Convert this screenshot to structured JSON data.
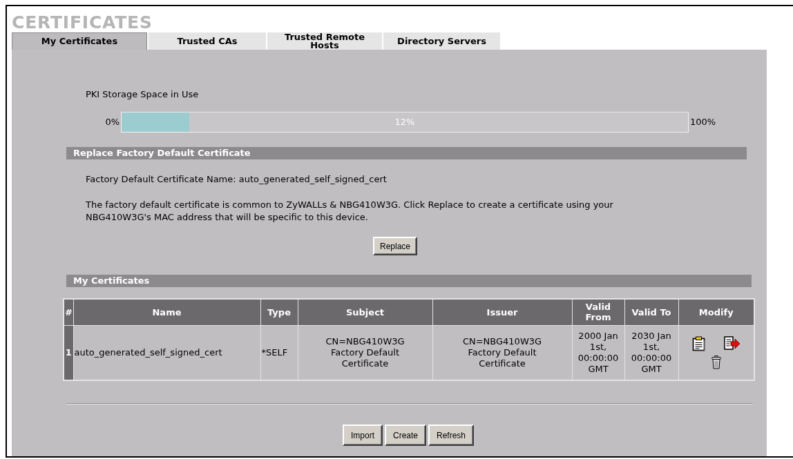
{
  "page": {
    "title": "CERTIFICATES"
  },
  "tabs": [
    {
      "label": "My Certificates",
      "selected": true
    },
    {
      "label": "Trusted CAs",
      "selected": false
    },
    {
      "label": "Trusted Remote Hosts",
      "selected": false
    },
    {
      "label": "Directory Servers",
      "selected": false
    }
  ],
  "storage": {
    "label": "PKI Storage Space in Use",
    "min_label": "0%",
    "max_label": "100%",
    "level": 0.12,
    "reading": "12%"
  },
  "replace_section": {
    "title": "Replace Factory Default Certificate",
    "name_line": "Factory Default Certificate Name: auto_generated_self_signed_cert",
    "description": "The factory default certificate is common to ZyWALLs & NBG410W3G. Click Replace to create a certificate using your NBG410W3G's MAC address that will be specific to this device.",
    "button": "Replace"
  },
  "certificates_section": {
    "title": "My Certificates",
    "table": {
      "columns": [
        "#",
        "Name",
        "Type",
        "Subject",
        "Issuer",
        "Valid From",
        "Valid To",
        "Modify"
      ],
      "rows": [
        {
          "number": "1",
          "name": "auto_generated_self_signed_cert",
          "type": "*SELF",
          "subject": "CN=NBG410W3G Factory Default Certificate",
          "issuer": "CN=NBG410W3G Factory Default Certificate",
          "valid_from": "2000 Jan 1st, 00:00:00 GMT",
          "valid_to": "2030 Jan 1st, 00:00:00 GMT"
        }
      ]
    }
  },
  "buttons": [
    "Import",
    "Create",
    "Refresh"
  ]
}
